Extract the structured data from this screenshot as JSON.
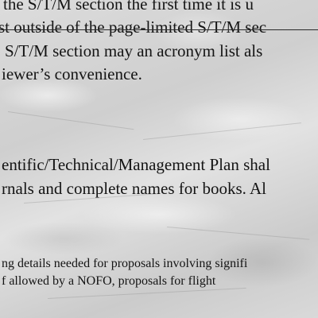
{
  "document": {
    "lines": [
      "the S/T/M section the first time it is u",
      "st outside of the page-limited S/T/M sec",
      "S/T/M section may an acronym list als",
      "iewer’s convenience.",
      "entific/Technical/Management Plan shal",
      "rnals and complete names for books. Al",
      "ng details needed for proposals involving signifi",
      "f allowed by a NOFO, proposals for flight"
    ]
  }
}
